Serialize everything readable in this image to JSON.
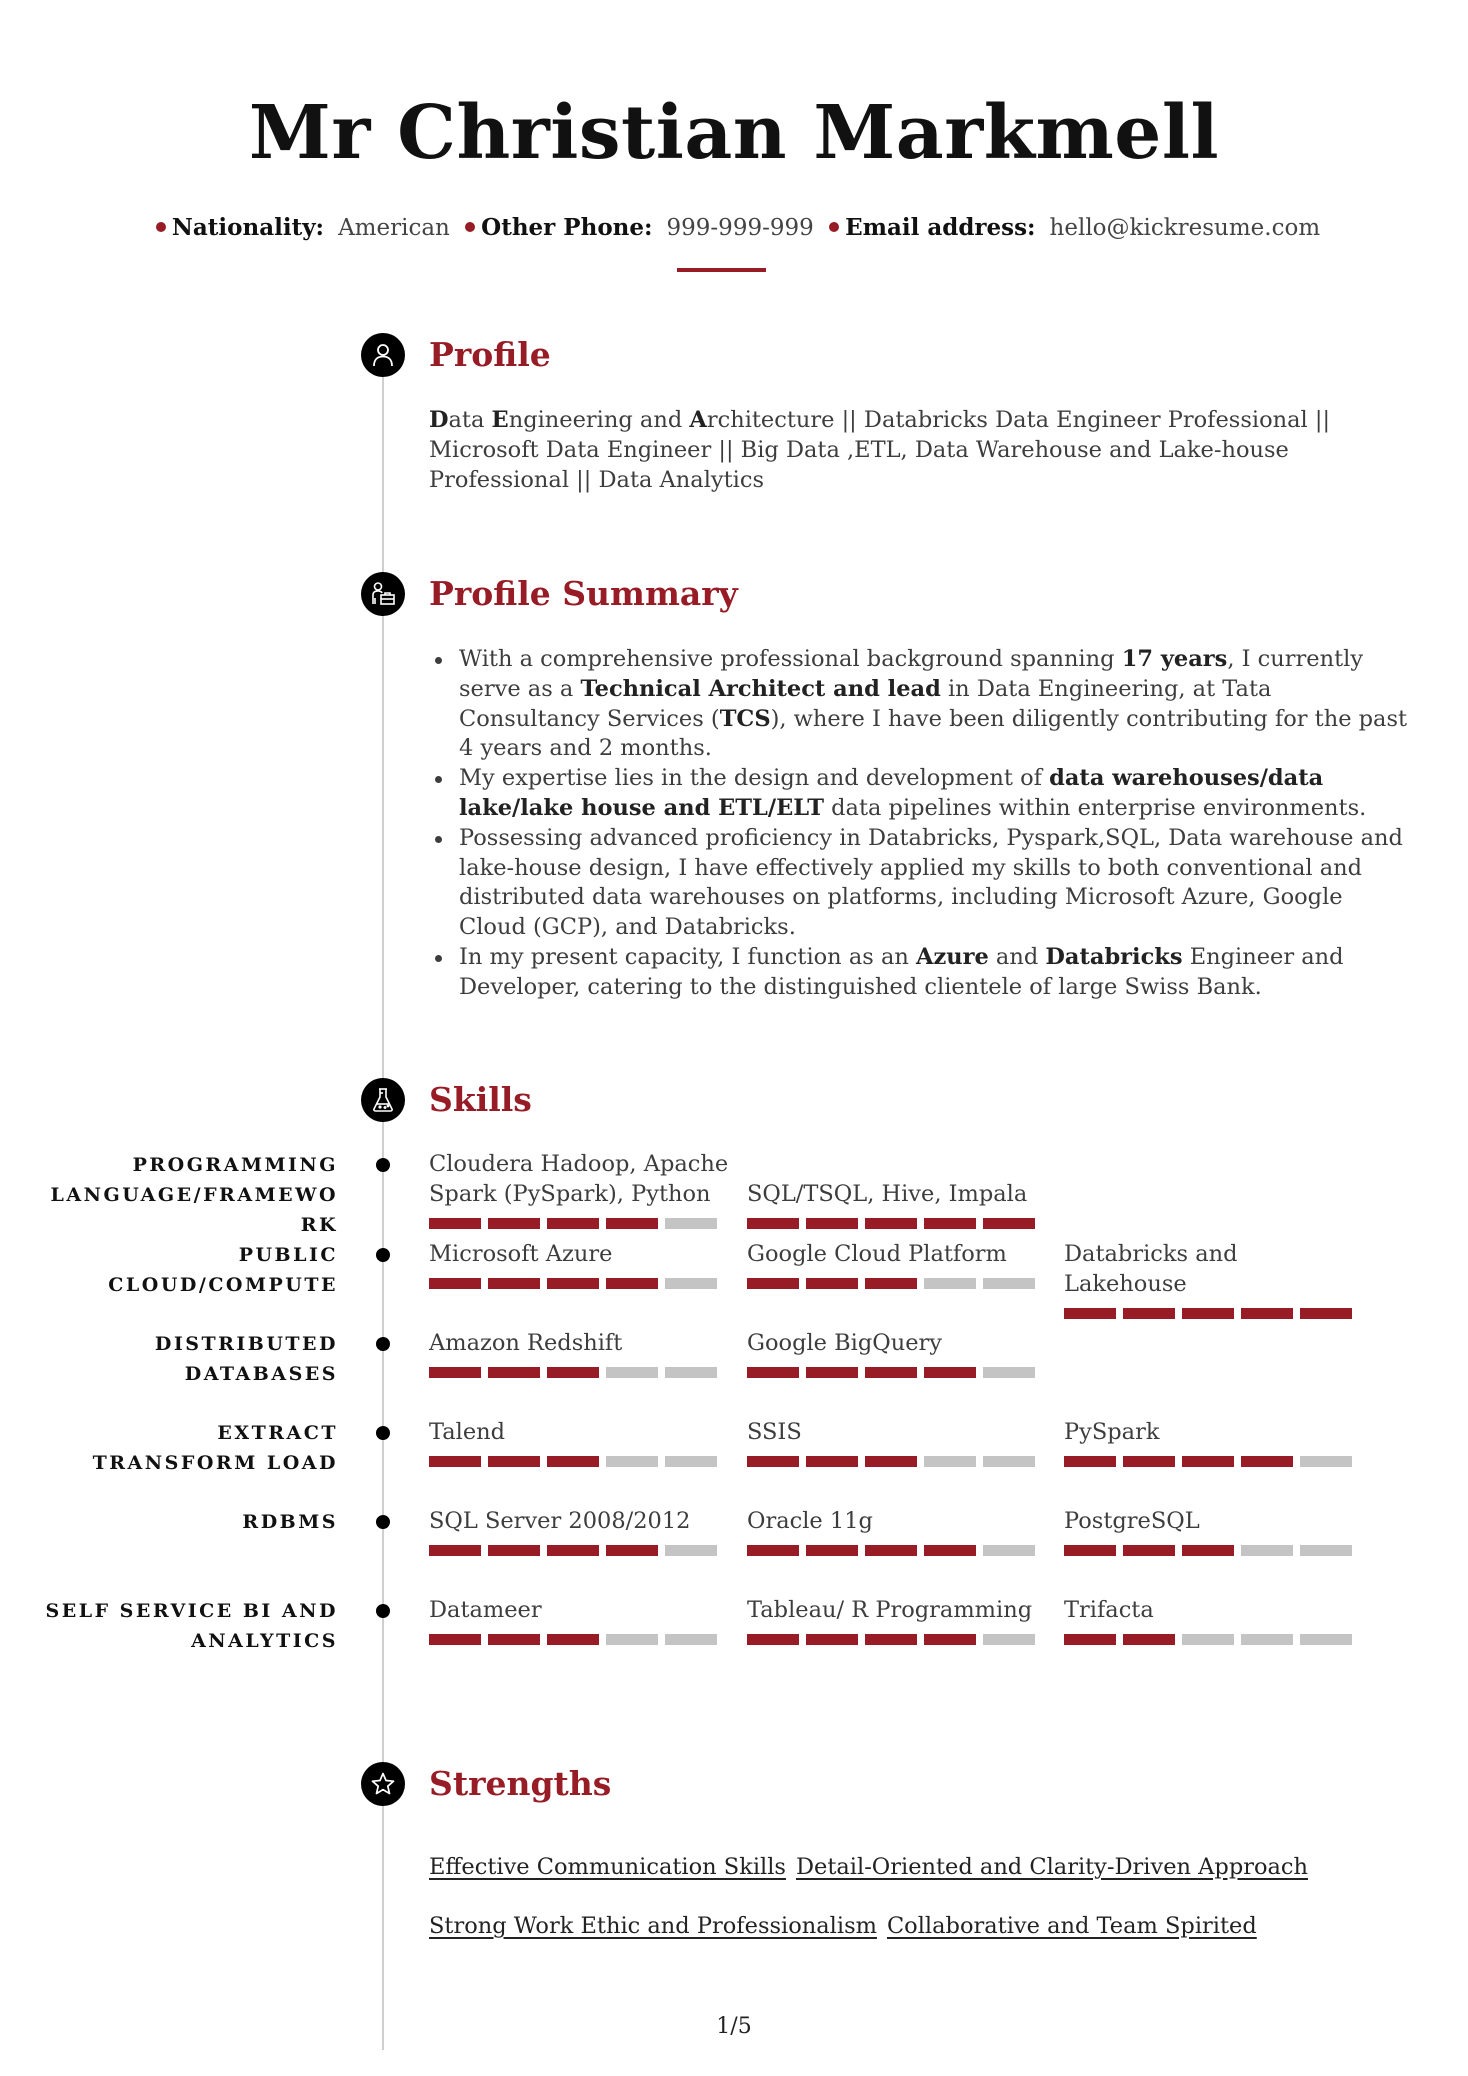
{
  "header": {
    "name": "Mr Christian Markmell",
    "contacts": [
      {
        "label": "Nationality:",
        "value": "American"
      },
      {
        "label": "Other Phone:",
        "value": "999-999-999"
      },
      {
        "label": "Email address:",
        "value": "hello@kickresume.com"
      }
    ]
  },
  "colors": {
    "accent": "#971c26",
    "bar_off": "#c4c4c4",
    "timeline": "#cfcfcf"
  },
  "profile": {
    "title": "Profile",
    "icon": "user-icon",
    "text_parts": [
      {
        "t": "D",
        "b": true
      },
      {
        "t": "ata ",
        "b": false
      },
      {
        "t": "E",
        "b": true
      },
      {
        "t": "ngineering and ",
        "b": false
      },
      {
        "t": "A",
        "b": true
      },
      {
        "t": "rchitecture || Databricks Data Engineer Professional || Microsoft Data Engineer || Big Data ,ETL, Data Warehouse and Lake-house Professional || Data Analytics",
        "b": false
      }
    ]
  },
  "summary": {
    "title": "Profile Summary",
    "icon": "user-briefcase-icon",
    "bullets": [
      [
        {
          "t": "With a comprehensive professional background spanning ",
          "b": false
        },
        {
          "t": "17 years",
          "b": true
        },
        {
          "t": ", I currently serve as a ",
          "b": false
        },
        {
          "t": "Technical Architect and lead",
          "b": true
        },
        {
          "t": " in Data Engineering, at Tata Consultancy Services (",
          "b": false
        },
        {
          "t": "TCS",
          "b": true
        },
        {
          "t": "), where I have been diligently contributing for the past 4 years and 2 months.",
          "b": false
        }
      ],
      [
        {
          "t": "My expertise lies in the design and development of ",
          "b": false
        },
        {
          "t": "data warehouses/data lake/lake house and ETL/ELT",
          "b": true
        },
        {
          "t": " data pipelines within enterprise environments.",
          "b": false
        }
      ],
      [
        {
          "t": "Possessing advanced proficiency in Databricks, Pyspark,SQL, Data warehouse and lake-house design, I have effectively applied my skills to both conventional and distributed data warehouses on platforms, including Microsoft Azure, Google Cloud (GCP), and Databricks.",
          "b": false
        }
      ],
      [
        {
          "t": "In my present capacity, I function as an ",
          "b": false
        },
        {
          "t": "Azure",
          "b": true
        },
        {
          "t": " and ",
          "b": false
        },
        {
          "t": "Databricks",
          "b": true
        },
        {
          "t": " Engineer and Developer, catering to the distinguished clientele of large Swiss Bank.",
          "b": false
        }
      ]
    ]
  },
  "skills": {
    "title": "Skills",
    "icon": "flask-icon",
    "max_level": 5,
    "categories": [
      {
        "label": "PROGRAMMING LANGUAGE/FRAMEWO RK",
        "label_lines": [
          "PROGRAMMING",
          "LANGUAGE/FRAMEWO",
          "RK"
        ],
        "items": [
          {
            "name_lines": [
              "Cloudera Hadoop, Apache",
              "Spark (PySpark), Python"
            ],
            "level": 4
          },
          {
            "name_lines": [
              "",
              "SQL/TSQL, Hive, Impala"
            ],
            "level": 5
          }
        ]
      },
      {
        "label": "PUBLIC CLOUD/COMPUTE",
        "label_lines": [
          "PUBLIC",
          "CLOUD/COMPUTE"
        ],
        "items": [
          {
            "name_lines": [
              "Microsoft Azure"
            ],
            "level": 4
          },
          {
            "name_lines": [
              "Google Cloud Platform"
            ],
            "level": 3
          },
          {
            "name_lines": [
              "Databricks and Lakehouse"
            ],
            "level": 5
          }
        ]
      },
      {
        "label": "DISTRIBUTED DATABASES",
        "label_lines": [
          "DISTRIBUTED",
          "DATABASES"
        ],
        "items": [
          {
            "name_lines": [
              "Amazon Redshift"
            ],
            "level": 3
          },
          {
            "name_lines": [
              "Google BigQuery"
            ],
            "level": 4
          }
        ]
      },
      {
        "label": "EXTRACT TRANSFORM LOAD",
        "label_lines": [
          "EXTRACT",
          "TRANSFORM LOAD"
        ],
        "items": [
          {
            "name_lines": [
              "Talend"
            ],
            "level": 3
          },
          {
            "name_lines": [
              "SSIS"
            ],
            "level": 3
          },
          {
            "name_lines": [
              "PySpark"
            ],
            "level": 4
          }
        ]
      },
      {
        "label": "RDBMS",
        "label_lines": [
          "RDBMS"
        ],
        "items": [
          {
            "name_lines": [
              "SQL Server 2008/2012"
            ],
            "level": 4
          },
          {
            "name_lines": [
              "Oracle 11g"
            ],
            "level": 4
          },
          {
            "name_lines": [
              "PostgreSQL"
            ],
            "level": 3
          }
        ]
      },
      {
        "label": "SELF SERVICE BI AND ANALYTICS",
        "label_lines": [
          "SELF SERVICE BI AND",
          "ANALYTICS"
        ],
        "items": [
          {
            "name_lines": [
              "Datameer"
            ],
            "level": 3
          },
          {
            "name_lines": [
              "Tableau/ R Programming"
            ],
            "level": 4
          },
          {
            "name_lines": [
              "Trifacta"
            ],
            "level": 2
          }
        ]
      }
    ]
  },
  "strengths": {
    "title": "Strengths",
    "icon": "star-icon",
    "rows": [
      [
        "Effective Communication Skills",
        "Detail-Oriented and Clarity-Driven Approach"
      ],
      [
        "Strong Work Ethic and Professionalism",
        "Collaborative and Team Spirited"
      ]
    ]
  },
  "footer": {
    "page": "1/5"
  }
}
